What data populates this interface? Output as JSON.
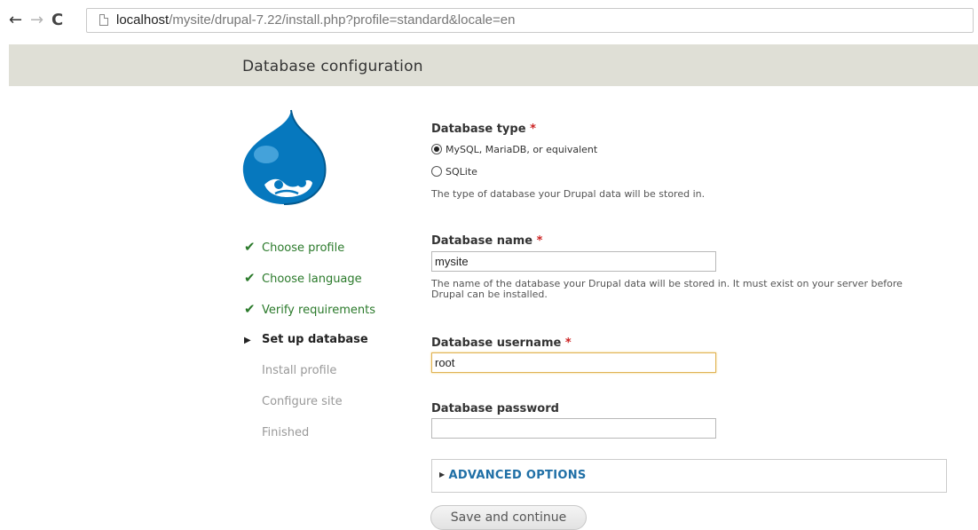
{
  "browser": {
    "back_glyph": "←",
    "forward_glyph": "→",
    "reload_glyph": "C",
    "url_host": "localhost",
    "url_path": "/mysite/drupal-7.22/install.php?profile=standard&locale=en"
  },
  "page": {
    "title": "Database configuration"
  },
  "tasks": [
    {
      "label": "Choose profile",
      "state": "done",
      "mark": "✔"
    },
    {
      "label": "Choose language",
      "state": "done",
      "mark": "✔"
    },
    {
      "label": "Verify requirements",
      "state": "done",
      "mark": "✔"
    },
    {
      "label": "Set up database",
      "state": "active",
      "mark": "▶"
    },
    {
      "label": "Install profile",
      "state": "pending",
      "mark": ""
    },
    {
      "label": "Configure site",
      "state": "pending",
      "mark": ""
    },
    {
      "label": "Finished",
      "state": "pending",
      "mark": ""
    }
  ],
  "form": {
    "db_type": {
      "label": "Database type",
      "required": "*",
      "options": [
        {
          "label": "MySQL, MariaDB, or equivalent",
          "checked": true
        },
        {
          "label": "SQLite",
          "checked": false
        }
      ],
      "description": "The type of database your Drupal data will be stored in."
    },
    "db_name": {
      "label": "Database name",
      "required": "*",
      "value": "mysite",
      "description": "The name of the database your Drupal data will be stored in. It must exist on your server before Drupal can be installed."
    },
    "db_username": {
      "label": "Database username",
      "required": "*",
      "value": "root"
    },
    "db_password": {
      "label": "Database password",
      "value": ""
    },
    "advanced": {
      "label": "ADVANCED OPTIONS"
    },
    "submit": {
      "label": "Save and continue"
    }
  },
  "colors": {
    "header_band": "#dfdfd6",
    "done_green": "#2b7a2b",
    "link_blue": "#1f6fa6",
    "required_red": "#cc2222",
    "logo_blue": "#0678be"
  }
}
